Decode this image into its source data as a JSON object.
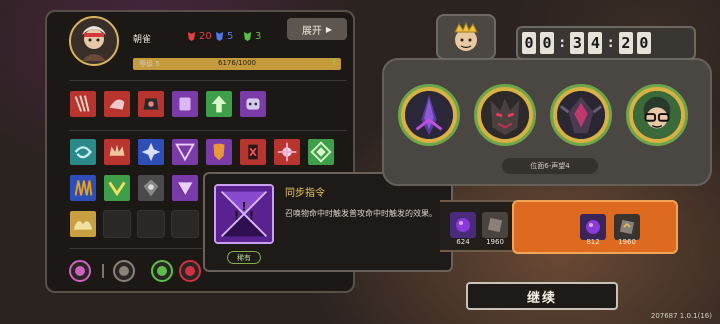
{
  "player": {
    "name": "朝雀",
    "stats": [
      {
        "icon": "red-mask-icon",
        "value": "20",
        "color": "#e04040"
      },
      {
        "icon": "blue-mask-icon",
        "value": "5",
        "color": "#4f7ae8"
      },
      {
        "icon": "green-mask-icon",
        "value": "3",
        "color": "#5cc048"
      }
    ],
    "expand_label": "展开",
    "level_label": "等级 5",
    "xp_text": "6176/1000",
    "xp_fraction": 1.0
  },
  "card_rows": {
    "row1": [
      {
        "name": "card-red-claws",
        "color": "#b8342f",
        "glyph": "claws"
      },
      {
        "name": "card-red-beast",
        "color": "#b8342f",
        "glyph": "beast"
      },
      {
        "name": "card-red-mech",
        "color": "#b8342f",
        "glyph": "mech"
      },
      {
        "name": "card-purple-armor",
        "color": "#7a3aa8",
        "glyph": "armor"
      },
      {
        "name": "card-green-arrows",
        "color": "#3f9e4a",
        "glyph": "arrows"
      },
      {
        "name": "card-purple-robot",
        "color": "#7a3aa8",
        "glyph": "robot"
      }
    ],
    "row2": [
      {
        "name": "card-teal-swirl",
        "color": "#2a8a8a",
        "glyph": "swirl"
      },
      {
        "name": "card-red-crown",
        "color": "#b8342f",
        "glyph": "crown"
      },
      {
        "name": "card-blue-star",
        "color": "#2f4fb8",
        "glyph": "star"
      },
      {
        "name": "card-purple-triangle",
        "color": "#7a3aa8",
        "glyph": "triangle"
      },
      {
        "name": "card-purple-shield",
        "color": "#7a3aa8",
        "glyph": "shield"
      },
      {
        "name": "card-red-rune",
        "color": "#b8342f",
        "glyph": "rune"
      },
      {
        "name": "card-red-flower",
        "color": "#b8342f",
        "glyph": "flower"
      },
      {
        "name": "card-green-diamond",
        "color": "#3f9e4a",
        "glyph": "diamond"
      }
    ],
    "row3": [
      {
        "name": "card-blue-spikes",
        "color": "#2f4fb8",
        "glyph": "spikes"
      },
      {
        "name": "card-green-chevron",
        "color": "#3f9e4a",
        "glyph": "chevron"
      },
      {
        "name": "card-grey-crest",
        "color": "#4a4a4a",
        "glyph": "crest"
      },
      {
        "name": "card-purple-prism",
        "color": "#7a3aa8",
        "glyph": "prism"
      },
      {
        "name": "card-red-blades",
        "color": "#b8342f",
        "glyph": "blades"
      }
    ],
    "row4": [
      {
        "name": "card-gold-wings",
        "color": "#c8a040",
        "glyph": "wings"
      },
      {
        "name": "card-empty",
        "color": "",
        "glyph": ""
      },
      {
        "name": "card-empty",
        "color": "",
        "glyph": ""
      },
      {
        "name": "card-empty",
        "color": "",
        "glyph": ""
      }
    ]
  },
  "bottom_icons": [
    {
      "name": "potion-icon",
      "color": "#d060c0"
    },
    {
      "name": "lance-icon",
      "color": "#8a8178"
    },
    {
      "name": "bloom-icon",
      "color": "#5cc048"
    },
    {
      "name": "rose-icon",
      "color": "#d03040"
    }
  ],
  "tooltip": {
    "title": "同步指令",
    "description": "召唤物命中时触发普攻命中时触发的效果。",
    "tag": "稀有"
  },
  "timer": {
    "digits": [
      "0",
      "0",
      "3",
      "4",
      "2",
      "0"
    ]
  },
  "boss_badge_icon": "boss-crown-icon",
  "nodes": [
    {
      "name": "node-purple-blade",
      "ring": "#6ea64b"
    },
    {
      "name": "node-demon-face",
      "ring": "#6ea64b"
    },
    {
      "name": "node-crystal-beast",
      "ring": "#6ea64b"
    },
    {
      "name": "node-masked-hero",
      "ring": "#6ea64b"
    }
  ],
  "position_label": "位面6-声望4",
  "rewards": {
    "dark": [
      {
        "icon": "purple-orb-icon",
        "value": "624"
      },
      {
        "icon": "stone-tablet-icon",
        "value": "1960"
      }
    ],
    "orange": [
      {
        "icon": "purple-orb-icon",
        "value": "812"
      },
      {
        "icon": "stone-tablet-icon",
        "value": "1960"
      }
    ]
  },
  "continue_label": "继续",
  "version": "207687 1.0.1(16)"
}
